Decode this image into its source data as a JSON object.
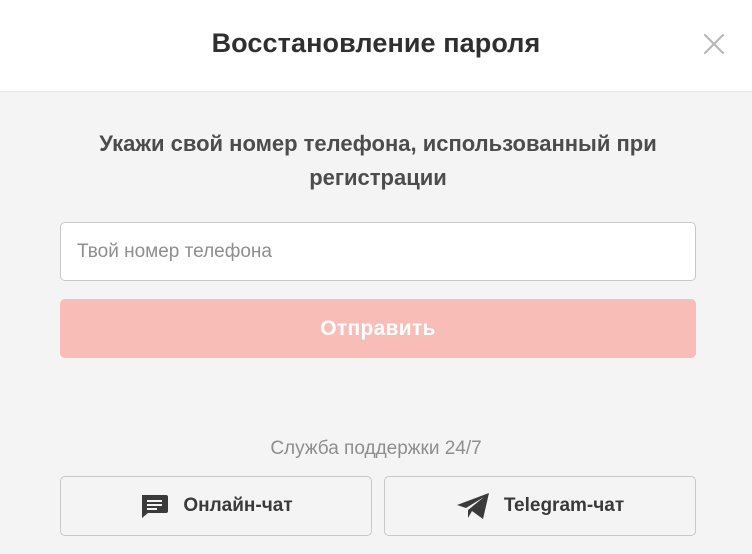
{
  "modal": {
    "title": "Восстановление пароля",
    "close_icon": "close-icon"
  },
  "form": {
    "instruction": "Укажи свой номер телефона, использованный при регистрации",
    "phone_placeholder": "Твой номер телефона",
    "phone_value": "",
    "submit_label": "Отправить"
  },
  "support": {
    "label": "Служба поддержки 24/7",
    "online_chat_label": "Онлайн-чат",
    "online_chat_icon": "chat-icon",
    "telegram_chat_label": "Telegram-чат",
    "telegram_chat_icon": "telegram-icon"
  },
  "colors": {
    "submit_bg": "#f8bdb6",
    "background": "#f3f4f3",
    "header_bg": "#ffffff",
    "icon_color": "#3a3a3a"
  }
}
